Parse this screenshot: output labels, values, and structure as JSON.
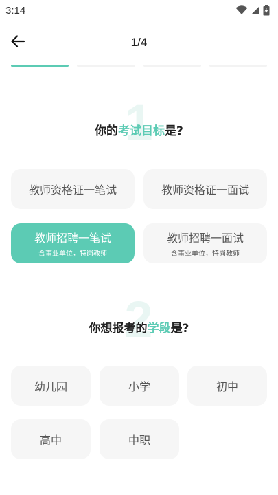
{
  "status_bar": {
    "time": "3:14"
  },
  "header": {
    "step": "1/4"
  },
  "progress": {
    "total": 4,
    "current": 1,
    "accent": "#5ccbb4"
  },
  "q1": {
    "number": "1",
    "prefix": "你的",
    "highlight": "考试目标",
    "suffix": "是?",
    "options": [
      {
        "label": "教师资格证一笔试",
        "sub": ""
      },
      {
        "label": "教师资格证一面试",
        "sub": ""
      },
      {
        "label": "教师招聘一笔试",
        "sub": "含事业单位，特岗教师",
        "selected": true
      },
      {
        "label": "教师招聘一面试",
        "sub": "含事业单位，特岗教师"
      }
    ]
  },
  "q2": {
    "number": "2",
    "prefix": "你想报考的",
    "highlight": "学段",
    "suffix": "是?",
    "options": [
      {
        "label": "幼儿园"
      },
      {
        "label": "小学"
      },
      {
        "label": "初中"
      },
      {
        "label": "高中"
      },
      {
        "label": "中职"
      }
    ]
  },
  "icons": {
    "back": "arrow-left-icon",
    "wifi": "wifi-icon",
    "signal": "signal-icon",
    "battery": "battery-charging-icon"
  }
}
